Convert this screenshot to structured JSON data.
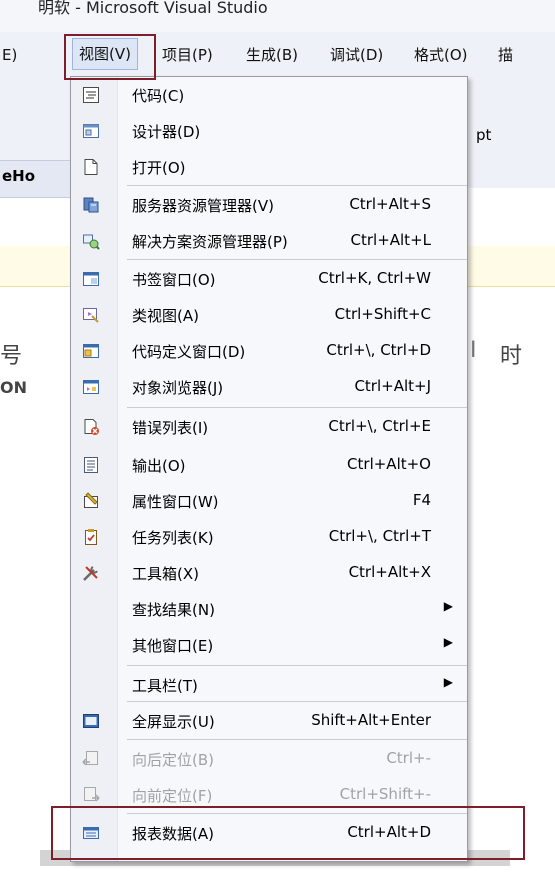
{
  "window": {
    "title": "明软 - Microsoft Visual Studio"
  },
  "menubar": {
    "items": [
      {
        "label": "E)"
      },
      {
        "label": "视图(V)"
      },
      {
        "label": "项目(P)"
      },
      {
        "label": "生成(B)"
      },
      {
        "label": "调试(D)"
      },
      {
        "label": "格式(O)"
      },
      {
        "label": "描"
      }
    ]
  },
  "background": {
    "toolbar_fragment": "pt",
    "tab_fragment": "eHo",
    "char_left": "号",
    "char_right": "时",
    "cell_left": "ON",
    "char_right_partial": "I"
  },
  "menu": {
    "items": [
      {
        "label": "代码(C)",
        "shortcut": "",
        "icon": "code-view-icon"
      },
      {
        "label": "设计器(D)",
        "shortcut": "",
        "icon": "designer-icon"
      },
      {
        "label": "打开(O)",
        "shortcut": "",
        "icon": "open-file-icon"
      },
      {
        "label": "服务器资源管理器(V)",
        "shortcut": "Ctrl+Alt+S",
        "icon": "server-explorer-icon"
      },
      {
        "label": "解决方案资源管理器(P)",
        "shortcut": "Ctrl+Alt+L",
        "icon": "solution-explorer-icon"
      },
      {
        "label": "书签窗口(O)",
        "shortcut": "Ctrl+K, Ctrl+W",
        "icon": "bookmark-window-icon"
      },
      {
        "label": "类视图(A)",
        "shortcut": "Ctrl+Shift+C",
        "icon": "class-view-icon"
      },
      {
        "label": "代码定义窗口(D)",
        "shortcut": "Ctrl+\\, Ctrl+D",
        "icon": "code-definition-icon"
      },
      {
        "label": "对象浏览器(J)",
        "shortcut": "Ctrl+Alt+J",
        "icon": "object-browser-icon"
      },
      {
        "label": "错误列表(I)",
        "shortcut": "Ctrl+\\, Ctrl+E",
        "icon": "error-list-icon"
      },
      {
        "label": "输出(O)",
        "shortcut": "Ctrl+Alt+O",
        "icon": "output-icon"
      },
      {
        "label": "属性窗口(W)",
        "shortcut": "F4",
        "icon": "properties-icon"
      },
      {
        "label": "任务列表(K)",
        "shortcut": "Ctrl+\\, Ctrl+T",
        "icon": "task-list-icon"
      },
      {
        "label": "工具箱(X)",
        "shortcut": "Ctrl+Alt+X",
        "icon": "toolbox-icon"
      },
      {
        "label": "查找结果(N)",
        "shortcut": "",
        "icon": "",
        "submenu": true
      },
      {
        "label": "其他窗口(E)",
        "shortcut": "",
        "icon": "",
        "submenu": true
      },
      {
        "label": "工具栏(T)",
        "shortcut": "",
        "icon": "",
        "submenu": true
      },
      {
        "label": "全屏显示(U)",
        "shortcut": "Shift+Alt+Enter",
        "icon": "fullscreen-icon"
      },
      {
        "label": "向后定位(B)",
        "shortcut": "Ctrl+-",
        "icon": "navigate-backward-icon",
        "disabled": true
      },
      {
        "label": "向前定位(F)",
        "shortcut": "Ctrl+Shift+-",
        "icon": "navigate-forward-icon",
        "disabled": true
      },
      {
        "label": "报表数据(A)",
        "shortcut": "Ctrl+Alt+D",
        "icon": "report-data-icon"
      }
    ],
    "submenu_arrow": "▶"
  },
  "colors": {
    "highlight_frame": "#7d1f2b",
    "menu_bg": "#f7f8fb",
    "disabled_text": "#a2a2a2"
  }
}
